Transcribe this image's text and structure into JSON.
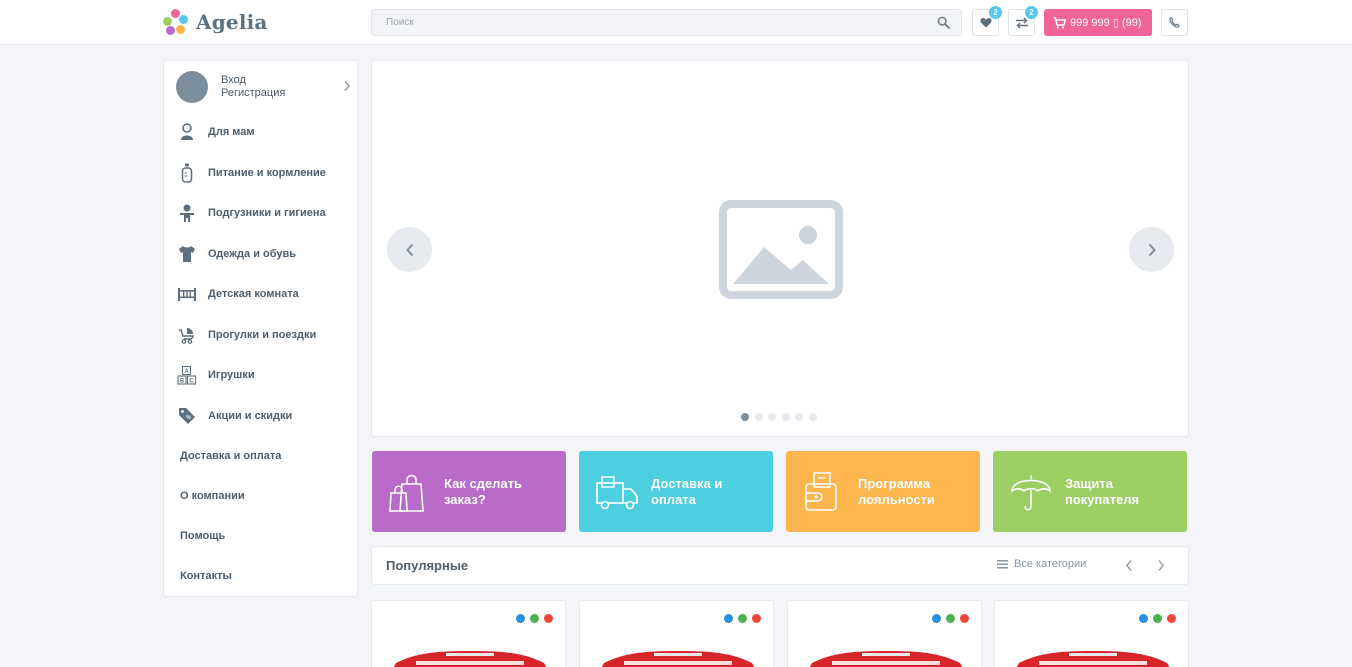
{
  "header": {
    "logo_text": "Agelia",
    "search_placeholder": "Поиск",
    "favorites_count": "2",
    "compare_count": "2",
    "cart_label": "999 999 ▯ (99)"
  },
  "sidebar": {
    "user_login": "Вход",
    "user_register": "Регистрация",
    "categories": [
      {
        "label": "Для мам",
        "icon": "mom-icon"
      },
      {
        "label": "Питание и кормление",
        "icon": "bottle-icon"
      },
      {
        "label": "Подгузники и гигиена",
        "icon": "baby-icon"
      },
      {
        "label": "Одежда и обувь",
        "icon": "bodysuit-icon"
      },
      {
        "label": "Детская комната",
        "icon": "crib-icon"
      },
      {
        "label": "Прогулки и поездки",
        "icon": "stroller-icon"
      },
      {
        "label": "Игрушки",
        "icon": "abc-blocks-icon"
      },
      {
        "label": "Акции и скидки",
        "icon": "tag-icon"
      }
    ],
    "links": [
      "Доставка и оплата",
      "О компании",
      "Помощь",
      "Контакты"
    ]
  },
  "slider": {
    "slides_count": 6,
    "active_slide": 1
  },
  "tiles": [
    {
      "line1": "Как сделать",
      "line2": "заказ?",
      "color": "#b86bc9",
      "icon": "shopping-bags-icon"
    },
    {
      "line1": "Доставка и",
      "line2": "оплата",
      "color": "#4dcfe0",
      "icon": "delivery-truck-icon"
    },
    {
      "line1": "Программа",
      "line2": "лояльности",
      "color": "#fdb64e",
      "icon": "wallet-icon"
    },
    {
      "line1": "Защита",
      "line2": "покупателя",
      "color": "#9bcf63",
      "icon": "umbrella-icon"
    }
  ],
  "popular": {
    "title": "Популярные",
    "all_categories": "Все категории"
  },
  "products": [
    {
      "swatches": [
        "#2e8fe0",
        "#4caf50",
        "#f04438"
      ]
    },
    {
      "swatches": [
        "#2e8fe0",
        "#4caf50",
        "#f04438"
      ]
    },
    {
      "swatches": [
        "#2e8fe0",
        "#4caf50",
        "#f04438"
      ]
    },
    {
      "swatches": [
        "#2e8fe0",
        "#4caf50",
        "#f04438"
      ]
    }
  ]
}
